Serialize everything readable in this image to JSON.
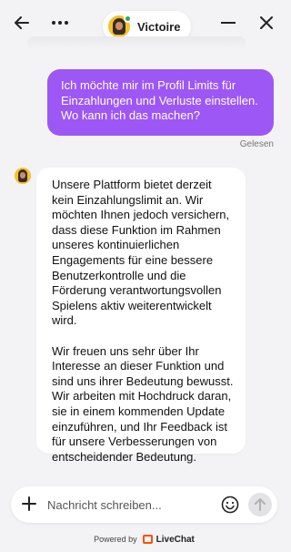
{
  "header": {
    "agent_name": "Victoire",
    "icons": {
      "back": "arrow-left-icon",
      "more": "more-horizontal-icon",
      "minimize": "minimize-icon",
      "close": "close-icon"
    },
    "status_color": "#2fa84f"
  },
  "messages": {
    "user_text": "Ich möchte mir im Profil Limits für Einzahlungen und Verluste einstellen. Wo kann ich das machen?",
    "read_status": "Gelesen",
    "bot_paragraph_1": "Unsere Plattform bietet derzeit kein Einzahlungslimit an. Wir möchten Ihnen jedoch versichern, dass diese Funktion im Rahmen unseres kontinuierlichen Engagements für eine bessere Benutzerkontrolle und die Förderung verantwortungsvollen Spielens aktiv weiterentwickelt wird.",
    "bot_paragraph_2": "Wir freuen uns sehr über Ihr Interesse an dieser Funktion und sind uns ihrer Bedeutung bewusst. Wir arbeiten mit Hochdruck daran, sie in einem kommenden Update einzuführen, und Ihr Feedback ist für unsere Verbesserungen von entscheidender Bedeutung."
  },
  "composer": {
    "placeholder": "Nachricht schreiben...",
    "icons": {
      "attach": "plus-icon",
      "emoji": "emoji-icon",
      "send": "send-arrow-icon"
    }
  },
  "footer": {
    "powered_by": "Powered by",
    "brand": "LiveChat"
  },
  "colors": {
    "user_bubble": "#9d57f5",
    "brand": "#ff5100",
    "background": "#f3f3f5"
  }
}
